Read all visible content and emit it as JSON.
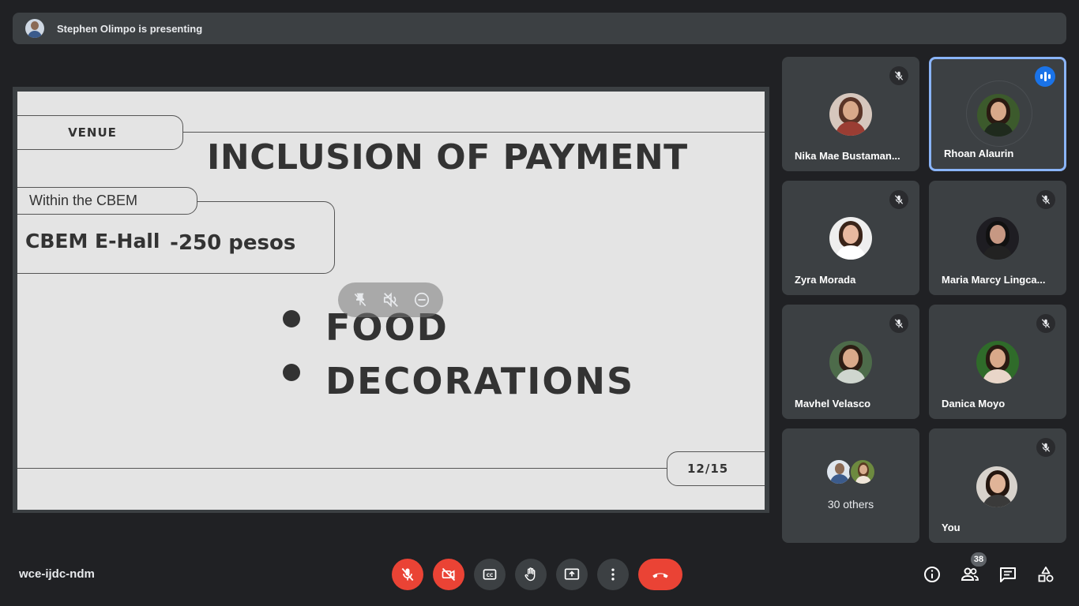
{
  "banner": {
    "presenter_text": "Stephen Olimpo is presenting"
  },
  "slide": {
    "venue_label": "VENUE",
    "title": "INCLUSION OF PAYMENT",
    "within_label": "Within the CBEM",
    "hall": "CBEM E-Hall",
    "price": "-250 pesos",
    "bullets": [
      "FOOD",
      "DECORATIONS"
    ],
    "page": "12/15"
  },
  "participants": [
    {
      "name": "Nika Mae Bustaman...",
      "muted": true
    },
    {
      "name": "Rhoan Alaurin",
      "muted": false,
      "speaking": true
    },
    {
      "name": "Zyra Morada",
      "muted": true
    },
    {
      "name": "Maria Marcy Lingca...",
      "muted": true
    },
    {
      "name": "Mavhel Velasco",
      "muted": true
    },
    {
      "name": "Danica Moyo",
      "muted": true
    },
    {
      "name": "You",
      "muted": true
    }
  ],
  "others": {
    "label": "30 others"
  },
  "meeting": {
    "code": "wce-ijdc-ndm",
    "participant_count": "38"
  },
  "colors": {
    "background": "#202124",
    "tile": "#3c4043",
    "danger": "#ea4335",
    "accent": "#8ab4f8",
    "speaking": "#1a73e8"
  },
  "icons": {
    "controls": [
      "mic-off-icon",
      "camera-off-icon",
      "captions-icon",
      "raise-hand-icon",
      "present-screen-icon",
      "more-options-icon",
      "end-call-icon"
    ],
    "right": [
      "info-icon",
      "people-icon",
      "chat-icon",
      "activities-icon"
    ],
    "overlay": [
      "unpin-icon",
      "mute-audio-icon",
      "remove-icon"
    ]
  }
}
